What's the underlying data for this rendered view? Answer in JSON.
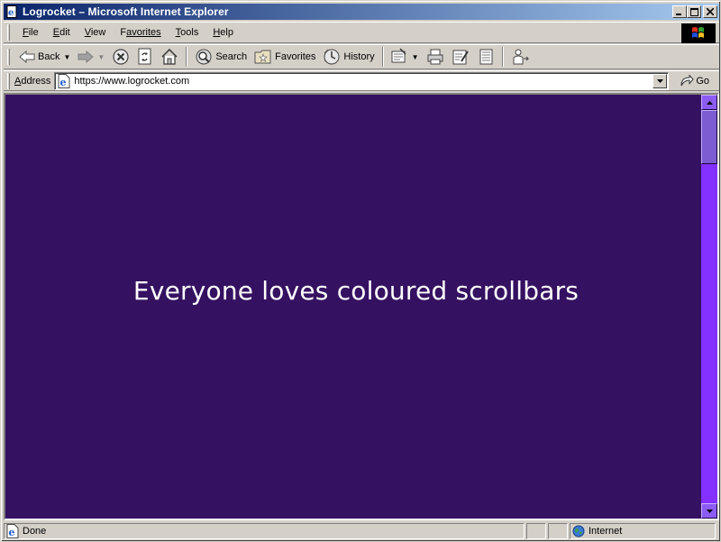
{
  "window": {
    "title": "Logrocket – Microsoft Internet Explorer",
    "minimize_glyph": "_",
    "maximize_glyph": "□",
    "close_glyph": "×"
  },
  "menubar": {
    "items": [
      {
        "accel": "F",
        "rest": "ile"
      },
      {
        "accel": "E",
        "rest": "dit"
      },
      {
        "accel": "V",
        "rest": "iew"
      },
      {
        "accel": "",
        "prefix": "F",
        "rest": "avorites"
      },
      {
        "accel": "T",
        "rest": "ools"
      },
      {
        "accel": "H",
        "rest": "elp"
      }
    ]
  },
  "toolbar": {
    "back_label": "Back",
    "search_label": "Search",
    "favorites_label": "Favorites",
    "history_label": "History"
  },
  "address": {
    "label_accel": "A",
    "label_rest": "ddress",
    "url": "https://www.logrocket.com",
    "go_label": "Go"
  },
  "page": {
    "headline": "Everyone loves coloured scrollbars",
    "background": "#351161",
    "scrollbar_track": "#8430ff",
    "scrollbar_thumb": "#7c5cd0",
    "scroll_position": 0
  },
  "statusbar": {
    "status_text": "Done",
    "zone_text": "Internet"
  }
}
